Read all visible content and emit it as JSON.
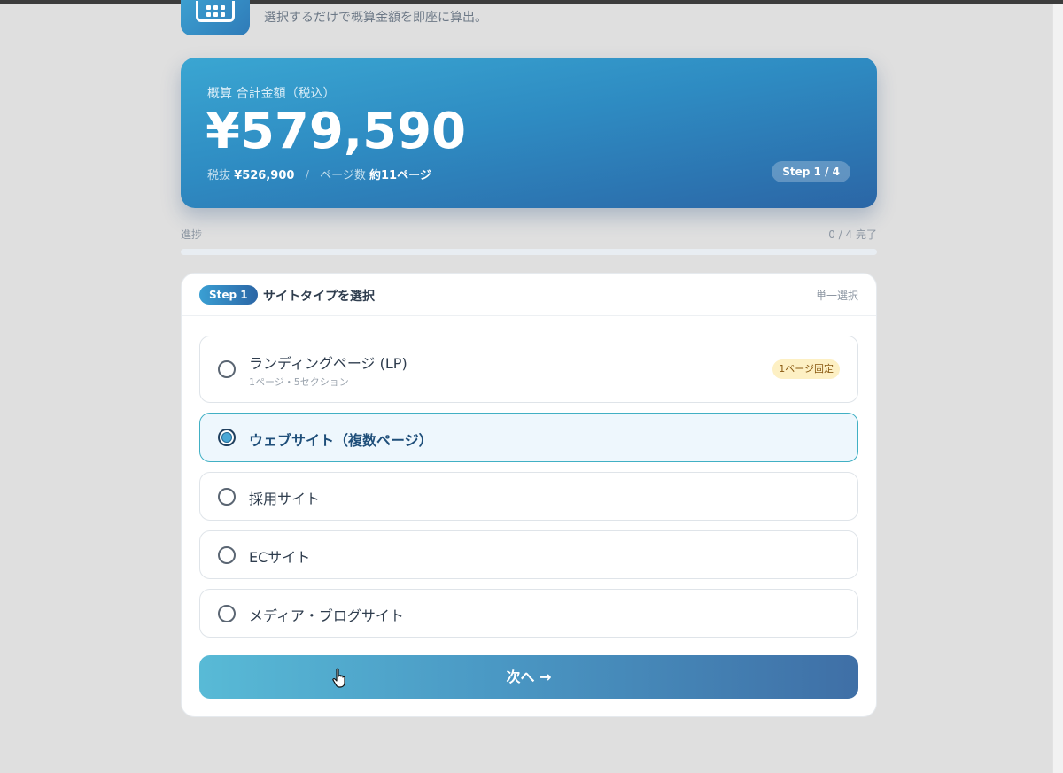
{
  "header": {
    "app_icon": "calculator-icon",
    "subtitle": "選択するだけで概算金額を即座に算出。"
  },
  "summary": {
    "label": "概算 合計金額（税込）",
    "total": "¥579,590",
    "tax_excluded_label": "税抜",
    "tax_excluded_value": "¥526,900",
    "separator": "/",
    "pages_label": "ページ数",
    "pages_value": "約11ページ",
    "step_indicator": "Step 1 / 4"
  },
  "progress": {
    "label": "進捗",
    "count": "0 / 4 完了",
    "fraction": 0
  },
  "step": {
    "badge": "Step 1",
    "title": "サイトタイプを選択",
    "mode": "単一選択",
    "options": [
      {
        "label": "ランディングページ (LP)",
        "sub": "1ページ・5セクション",
        "tag": "1ページ固定",
        "selected": false
      },
      {
        "label": "ウェブサイト（複数ページ）",
        "selected": true
      },
      {
        "label": "採用サイト",
        "selected": false
      },
      {
        "label": "ECサイト",
        "selected": false
      },
      {
        "label": "メディア・ブログサイト",
        "selected": false
      }
    ],
    "next_label": "次へ →"
  },
  "colors": {
    "accent": "#2e8bc2",
    "selected_border": "#41b0c4",
    "tag_bg": "#fdf0c4"
  }
}
